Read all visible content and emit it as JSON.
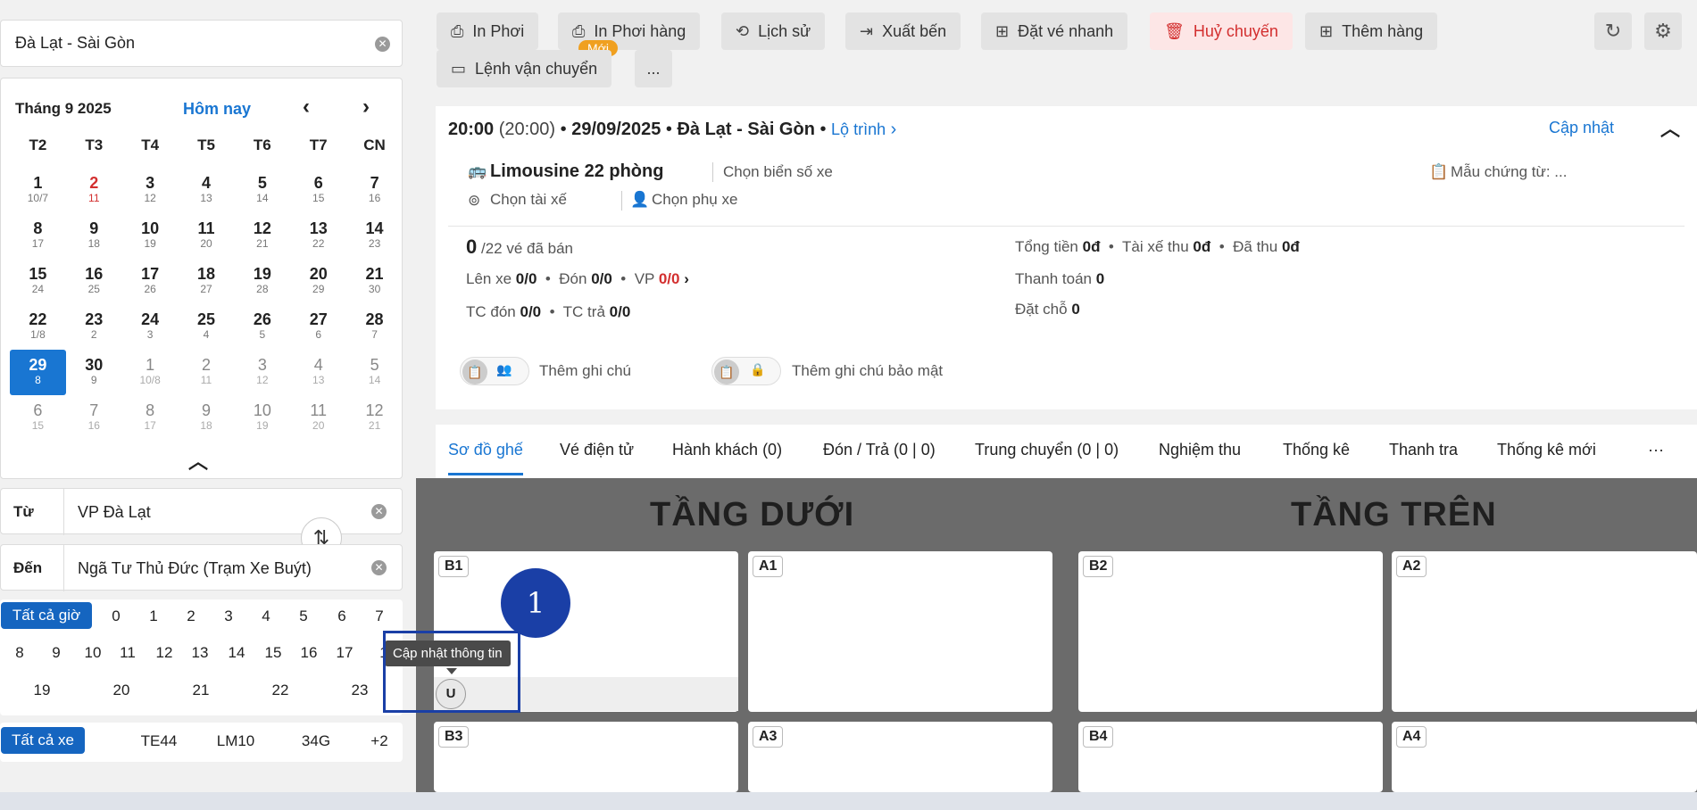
{
  "route": {
    "value": "Đà Lạt - Sài Gòn"
  },
  "calendar": {
    "month_label": "Tháng 9 2025",
    "today_label": "Hôm nay",
    "weekdays": [
      "T2",
      "T3",
      "T4",
      "T5",
      "T6",
      "T7",
      "CN"
    ],
    "days": [
      {
        "n": "1",
        "l": "10/7"
      },
      {
        "n": "2",
        "l": "11",
        "red": true
      },
      {
        "n": "3",
        "l": "12"
      },
      {
        "n": "4",
        "l": "13"
      },
      {
        "n": "5",
        "l": "14"
      },
      {
        "n": "6",
        "l": "15"
      },
      {
        "n": "7",
        "l": "16"
      },
      {
        "n": "8",
        "l": "17"
      },
      {
        "n": "9",
        "l": "18"
      },
      {
        "n": "10",
        "l": "19"
      },
      {
        "n": "11",
        "l": "20"
      },
      {
        "n": "12",
        "l": "21"
      },
      {
        "n": "13",
        "l": "22"
      },
      {
        "n": "14",
        "l": "23"
      },
      {
        "n": "15",
        "l": "24"
      },
      {
        "n": "16",
        "l": "25"
      },
      {
        "n": "17",
        "l": "26"
      },
      {
        "n": "18",
        "l": "27"
      },
      {
        "n": "19",
        "l": "28"
      },
      {
        "n": "20",
        "l": "29"
      },
      {
        "n": "21",
        "l": "30"
      },
      {
        "n": "22",
        "l": "1/8"
      },
      {
        "n": "23",
        "l": "2"
      },
      {
        "n": "24",
        "l": "3"
      },
      {
        "n": "25",
        "l": "4"
      },
      {
        "n": "26",
        "l": "5"
      },
      {
        "n": "27",
        "l": "6"
      },
      {
        "n": "28",
        "l": "7"
      },
      {
        "n": "29",
        "l": "8",
        "sel": true
      },
      {
        "n": "30",
        "l": "9"
      },
      {
        "n": "1",
        "l": "10/8",
        "other": true
      },
      {
        "n": "2",
        "l": "11",
        "other": true
      },
      {
        "n": "3",
        "l": "12",
        "other": true
      },
      {
        "n": "4",
        "l": "13",
        "other": true
      },
      {
        "n": "5",
        "l": "14",
        "other": true
      },
      {
        "n": "6",
        "l": "15",
        "other": true
      },
      {
        "n": "7",
        "l": "16",
        "other": true
      },
      {
        "n": "8",
        "l": "17",
        "other": true
      },
      {
        "n": "9",
        "l": "18",
        "other": true
      },
      {
        "n": "10",
        "l": "19",
        "other": true
      },
      {
        "n": "11",
        "l": "20",
        "other": true
      },
      {
        "n": "12",
        "l": "21",
        "other": true
      }
    ]
  },
  "from": {
    "label": "Từ",
    "value": "VP Đà Lạt"
  },
  "to": {
    "label": "Đến",
    "value": "Ngã Tư Thủ Đức (Trạm Xe Buýt)"
  },
  "hours": {
    "all_label": "Tất cả giờ",
    "row1": [
      "0",
      "1",
      "2",
      "3",
      "4",
      "5",
      "6",
      "7"
    ],
    "row2": [
      "8",
      "9",
      "10",
      "11",
      "12",
      "13",
      "14",
      "15",
      "16",
      "17",
      "1"
    ],
    "row3": [
      "19",
      "20",
      "21",
      "22",
      "23"
    ]
  },
  "vehicles": {
    "all_label": "Tất cả xe",
    "items": [
      "TE44",
      "LM10",
      "34G",
      "+2"
    ]
  },
  "toolbar": {
    "in_phoi": "In Phơi",
    "in_phoi_hang": "In Phơi hàng",
    "new_badge": "Mới",
    "lich_su": "Lịch sử",
    "xuat_ben": "Xuất bến",
    "dat_ve_nhanh": "Đặt vé nhanh",
    "huy_chuyen": "Huỷ chuyến",
    "them_hang": "Thêm hàng",
    "lenh_van_chuyen": "Lệnh vận chuyển",
    "more": "..."
  },
  "trip": {
    "time": "20:00",
    "time_paren": "(20:00)",
    "date": "29/09/2025",
    "route": "Đà Lạt - Sài Gòn",
    "lo_trinh": "Lộ trình",
    "update": "Cập nhật",
    "vehicle_type": "Limousine 22 phòng",
    "plate": "Chọn biển số xe",
    "template": "Mẫu chứng từ: ...",
    "driver": "Chọn tài xế",
    "assistant": "Chọn phụ xe",
    "sold_count": "0",
    "sold_total": "/22 vé đã bán",
    "len_xe_label": "Lên xe",
    "len_xe": "0/0",
    "don_label": "Đón",
    "don": "0/0",
    "vp_label": "VP",
    "vp": "0/0",
    "tc_don_label": "TC đón",
    "tc_don": "0/0",
    "tc_tra_label": "TC trả",
    "tc_tra": "0/0",
    "tong_tien_label": "Tổng tiền",
    "tong_tien": "0đ",
    "tai_xe_thu_label": "Tài xế thu",
    "tai_xe_thu": "0đ",
    "da_thu_label": "Đã thu",
    "da_thu": "0đ",
    "thanh_toan_label": "Thanh toán",
    "thanh_toan": "0",
    "dat_cho_label": "Đặt chỗ",
    "dat_cho": "0",
    "note": "Thêm ghi chú",
    "secure_note": "Thêm ghi chú bảo mật"
  },
  "tabs": [
    "Sơ đồ ghế",
    "Vé điện tử",
    "Hành khách (0)",
    "Đón / Trả (0 | 0)",
    "Trung chuyển (0 | 0)",
    "Nghiệm thu",
    "Thống kê",
    "Thanh tra",
    "Thống kê mới",
    "···"
  ],
  "seatmap": {
    "lower": "TẦNG DƯỚI",
    "upper": "TẦNG TRÊN",
    "seats": [
      "B1",
      "A1",
      "B2",
      "A2",
      "B3",
      "A3",
      "B4",
      "A4"
    ],
    "tooltip": "Cập nhật thông tin",
    "u_label": "U",
    "step_number": "1"
  },
  "colors": {
    "accent": "#1976d2",
    "danger": "#d32f2f",
    "highlight": "#1a3fa6"
  }
}
